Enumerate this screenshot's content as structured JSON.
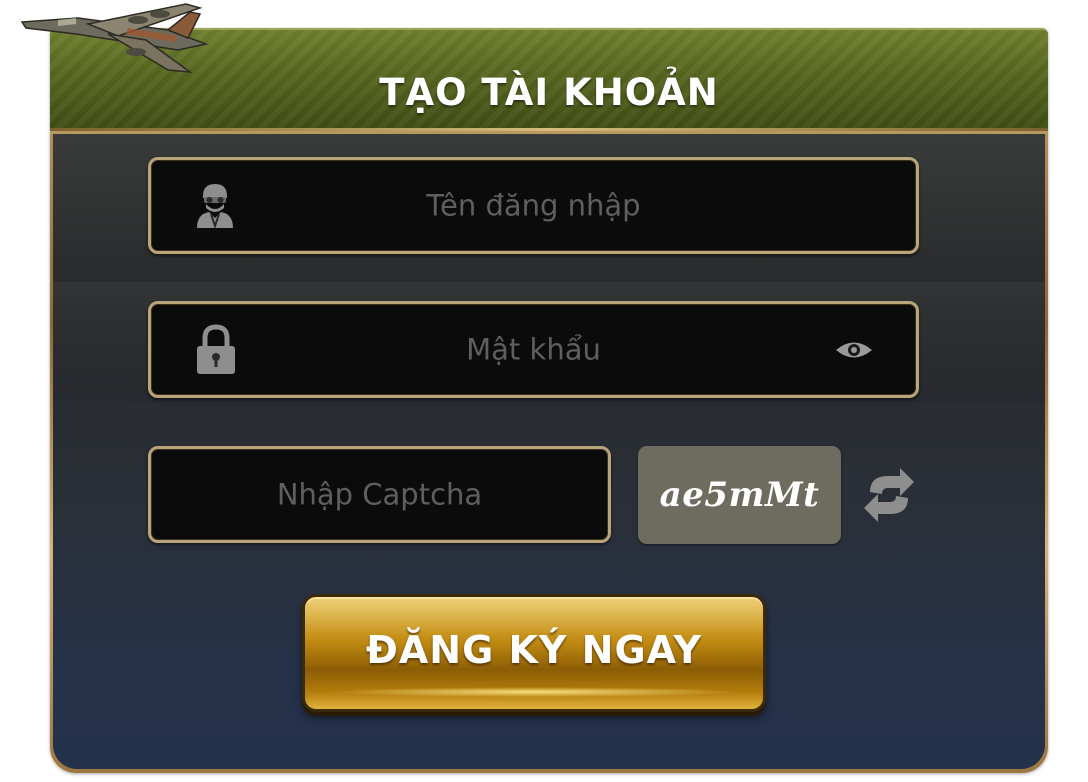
{
  "header": {
    "title": "TẠO TÀI KHOẢN",
    "logo_icon": "airplane-icon"
  },
  "form": {
    "username": {
      "placeholder": "Tên đăng nhập",
      "value": "",
      "icon": "soldier-avatar-icon"
    },
    "password": {
      "placeholder": "Mật khẩu",
      "value": "",
      "icon": "lock-icon",
      "toggle_icon": "eye-icon"
    },
    "captcha": {
      "placeholder": "Nhập Captcha",
      "value": "",
      "code": "ae5mMt",
      "refresh_icon": "refresh-icon"
    },
    "submit_label": "ĐĂNG KÝ NGAY"
  },
  "colors": {
    "header_green": "#56661f",
    "field_bg": "#0b0b0b",
    "field_border": "#b9a57a",
    "placeholder": "#5f5f5f",
    "captcha_bg": "#6e6c5f",
    "button_gold": "#c08a12"
  }
}
